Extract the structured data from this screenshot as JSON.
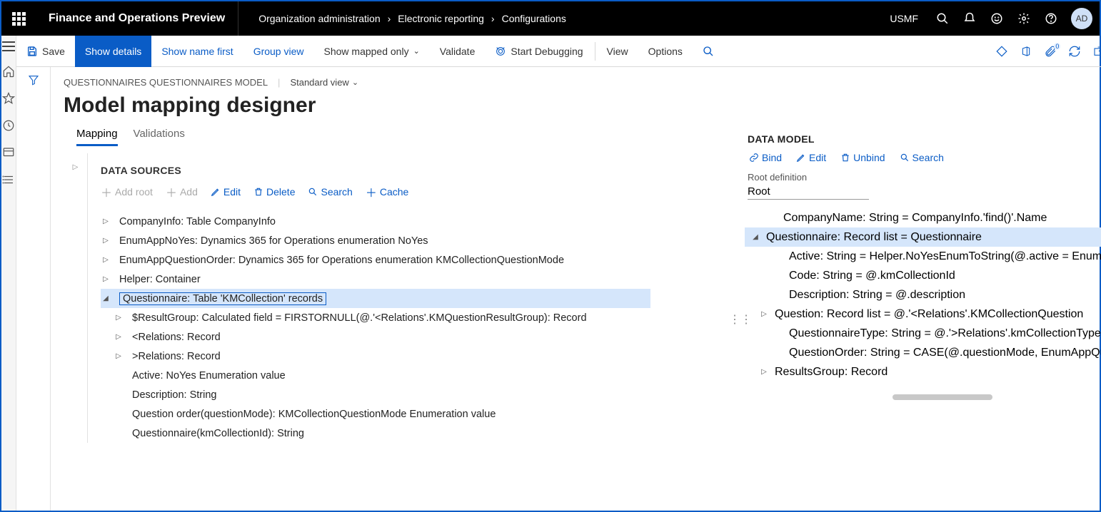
{
  "topbar": {
    "app_title": "Finance and Operations Preview",
    "breadcrumb": [
      "Organization administration",
      "Electronic reporting",
      "Configurations"
    ],
    "company": "USMF",
    "avatar": "AD"
  },
  "actionbar": {
    "save": "Save",
    "show_details": "Show details",
    "show_name_first": "Show name first",
    "group_view": "Group view",
    "show_mapped_only": "Show mapped only",
    "validate": "Validate",
    "start_debugging": "Start Debugging",
    "view": "View",
    "options": "Options",
    "badge": "0"
  },
  "page_header": {
    "context": "QUESTIONNAIRES QUESTIONNAIRES MODEL",
    "view": "Standard view",
    "title": "Model mapping designer"
  },
  "tabs": {
    "mapping": "Mapping",
    "validations": "Validations"
  },
  "datasources": {
    "title": "DATA SOURCES",
    "add_root": "Add root",
    "add": "Add",
    "edit": "Edit",
    "delete": "Delete",
    "search": "Search",
    "cache": "Cache",
    "tree": [
      {
        "caret": "closed",
        "indent": 0,
        "text": "CompanyInfo: Table CompanyInfo"
      },
      {
        "caret": "closed",
        "indent": 0,
        "text": "EnumAppNoYes: Dynamics 365 for Operations enumeration NoYes"
      },
      {
        "caret": "closed",
        "indent": 0,
        "text": "EnumAppQuestionOrder: Dynamics 365 for Operations enumeration KMCollectionQuestionMode"
      },
      {
        "caret": "closed",
        "indent": 0,
        "text": "Helper: Container"
      },
      {
        "caret": "open",
        "indent": 0,
        "text": "Questionnaire: Table 'KMCollection' records",
        "selected": true
      },
      {
        "caret": "closed",
        "indent": 1,
        "text": "$ResultGroup: Calculated field = FIRSTORNULL(@.'<Relations'.KMQuestionResultGroup): Record"
      },
      {
        "caret": "closed",
        "indent": 1,
        "text": "<Relations: Record"
      },
      {
        "caret": "closed",
        "indent": 1,
        "text": ">Relations: Record"
      },
      {
        "caret": "none",
        "indent": 1,
        "text": "Active: NoYes Enumeration value"
      },
      {
        "caret": "none",
        "indent": 1,
        "text": "Description: String"
      },
      {
        "caret": "none",
        "indent": 1,
        "text": "Question order(questionMode): KMCollectionQuestionMode Enumeration value"
      },
      {
        "caret": "none",
        "indent": 1,
        "text": "Questionnaire(kmCollectionId): String"
      }
    ]
  },
  "datamodel": {
    "title": "DATA MODEL",
    "bind": "Bind",
    "edit": "Edit",
    "unbind": "Unbind",
    "search": "Search",
    "root_label": "Root definition",
    "root_value": "Root",
    "tree": [
      {
        "caret": "none",
        "indent": 0,
        "text": "CompanyName: String = CompanyInfo.'find()'.Name"
      },
      {
        "caret": "open",
        "indent": 1,
        "text": "Questionnaire: Record list = Questionnaire",
        "selected": true
      },
      {
        "caret": "none",
        "indent": 2,
        "text": "Active: String = Helper.NoYesEnumToString(@.active = EnumAppNo"
      },
      {
        "caret": "none",
        "indent": 2,
        "text": "Code: String = @.kmCollectionId"
      },
      {
        "caret": "none",
        "indent": 2,
        "text": "Description: String = @.description"
      },
      {
        "caret": "closed",
        "indent": 3,
        "text": "Question: Record list = @.'<Relations'.KMCollectionQuestion"
      },
      {
        "caret": "none",
        "indent": 2,
        "text": "QuestionnaireType: String = @.'>Relations'.kmCollectionTypeId.desc"
      },
      {
        "caret": "none",
        "indent": 2,
        "text": "QuestionOrder: String = CASE(@.questionMode, EnumAppQuestion"
      },
      {
        "caret": "closed",
        "indent": 3,
        "text": "ResultsGroup: Record"
      }
    ]
  }
}
